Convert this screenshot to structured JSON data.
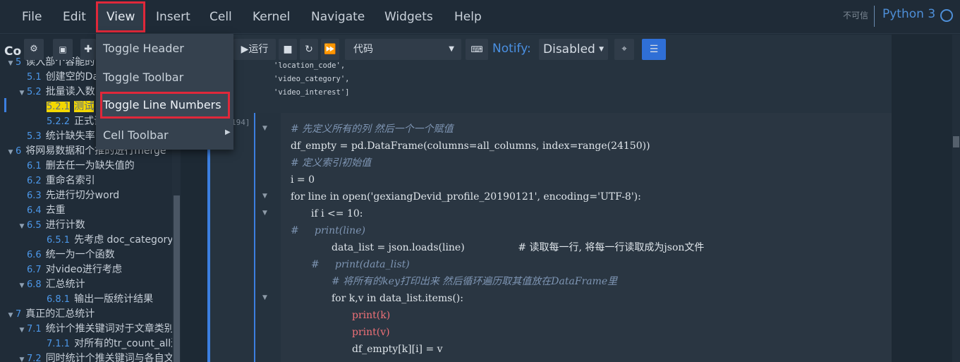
{
  "menubar": {
    "items": [
      "File",
      "Edit",
      "View",
      "Insert",
      "Cell",
      "Kernel",
      "Navigate",
      "Widgets",
      "Help"
    ],
    "trust": "不可信",
    "kernel": "Python 3"
  },
  "view_menu": {
    "items": [
      "Toggle Header",
      "Toggle Toolbar",
      "Toggle Line Numbers",
      "Cell Toolbar"
    ],
    "highlighted": "Toggle Line Numbers"
  },
  "toolbar": {
    "run": "运行",
    "cell_type": "代码",
    "notify_label": "Notify:",
    "notify_value": "Disabled"
  },
  "sidebar": {
    "title": "Co",
    "items": [
      {
        "num": "5",
        "text": "读入部个容能的",
        "level": 1,
        "caret": true
      },
      {
        "num": "5.1",
        "text": "创建空的Da",
        "level": 2
      },
      {
        "num": "5.2",
        "text": "批量读入数",
        "level": 2,
        "caret": true
      },
      {
        "num": "5.2.1",
        "text": "测试",
        "level": 3,
        "highlight": true
      },
      {
        "num": "5.2.2",
        "text": "正式读",
        "level": 3
      },
      {
        "num": "5.3",
        "text": "统计缺失率",
        "level": 2
      },
      {
        "num": "6",
        "text": "将网易数据和个推的进行merge",
        "level": 1,
        "caret": true
      },
      {
        "num": "6.1",
        "text": "删去任一为缺失值的",
        "level": 2
      },
      {
        "num": "6.2",
        "text": "重命名索引",
        "level": 2
      },
      {
        "num": "6.3",
        "text": "先进行切分word",
        "level": 2
      },
      {
        "num": "6.4",
        "text": "去重",
        "level": 2
      },
      {
        "num": "6.5",
        "text": "进行计数",
        "level": 2,
        "caret": true
      },
      {
        "num": "6.5.1",
        "text": "先考虑 doc_category 生",
        "level": 3
      },
      {
        "num": "6.6",
        "text": "统一为一个函数",
        "level": 2
      },
      {
        "num": "6.7",
        "text": "对video进行考虑",
        "level": 2
      },
      {
        "num": "6.8",
        "text": "汇总统计",
        "level": 2,
        "caret": true
      },
      {
        "num": "6.8.1",
        "text": "输出一版统计结果",
        "level": 3
      },
      {
        "num": "7",
        "text": "真正的汇总统计",
        "level": 1,
        "caret": true
      },
      {
        "num": "7.1",
        "text": "统计个推关键词对于文章类别",
        "level": 2,
        "caret": true
      },
      {
        "num": "7.1.1",
        "text": "对所有的tr_count_all进行",
        "level": 3
      },
      {
        "num": "7.2",
        "text": "同时统计个推关键词与各自文",
        "level": 2,
        "caret": true
      }
    ]
  },
  "output": {
    "lines": [
      "'location_code',",
      "'video_category',",
      "'video_interest']"
    ]
  },
  "cell": {
    "prompt": "194]"
  },
  "code_lines": [
    {
      "t": "# 先定义所有的列 然后一个一个赋值",
      "c": "cmt",
      "ind": 0,
      "fold": true
    },
    {
      "t": "df_empty = pd.DataFrame(columns=all_columns, index=range(24150))",
      "ind": 0
    },
    {
      "t": "# 定义索引初始值",
      "c": "cmt",
      "ind": 0
    },
    {
      "t": "i = 0",
      "ind": 0
    },
    {
      "t": "for line in open('gexiangDevid_profile_20190121', encoding='UTF-8'):",
      "ind": 0,
      "fold": true
    },
    {
      "t": "if i <= 10:",
      "ind": 1,
      "fold": true
    },
    {
      "t": "#     print(line)",
      "c": "cmt",
      "ind": 0
    },
    {
      "t": "data_list = json.loads(line)                 # 读取每一行, 将每一行读取成为json文件",
      "ind": 2
    },
    {
      "t": "#     print(data_list)",
      "c": "cmt",
      "ind": 1
    },
    {
      "t": "# 将所有的key打印出来 然后循环遍历取其值放在DataFrame里",
      "c": "cmt",
      "ind": 2
    },
    {
      "t": "for k,v in data_list.items():",
      "ind": 2,
      "fold": true
    },
    {
      "t": "print(k)",
      "ind": 3,
      "c": "bi"
    },
    {
      "t": "print(v)",
      "ind": 3,
      "c": "bi"
    },
    {
      "t": "df_empty[k][i] = v",
      "ind": 3
    }
  ]
}
